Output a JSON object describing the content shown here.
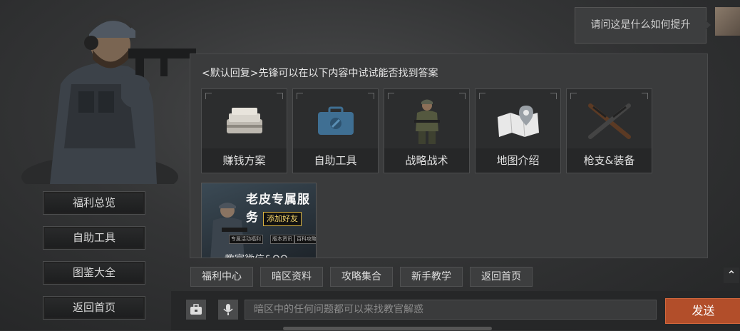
{
  "left_menu": {
    "items": [
      {
        "label": "福利总览"
      },
      {
        "label": "自助工具"
      },
      {
        "label": "图鉴大全"
      },
      {
        "label": "返回首页"
      }
    ]
  },
  "chat": {
    "user_message": "请问这是什么如何提升",
    "bot_reply": "<默认回复>先锋可以在以下内容中试试能否找到答案",
    "cards": [
      {
        "label": "赚钱方案",
        "icon": "cash-stack-icon"
      },
      {
        "label": "自助工具",
        "icon": "toolbox-icon"
      },
      {
        "label": "战略战术",
        "icon": "soldier-icon"
      },
      {
        "label": "地图介绍",
        "icon": "map-pin-icon"
      },
      {
        "label": "枪支&装备",
        "icon": "rifles-icon"
      }
    ],
    "promo": {
      "title": "老皮专属服务",
      "button": "添加好友",
      "rows": [
        "专属活动福利",
        "版本资讯",
        "百科攻略"
      ],
      "bottom_text": "教官微信&QQ"
    }
  },
  "quick_buttons": [
    {
      "label": "福利中心"
    },
    {
      "label": "暗区资料"
    },
    {
      "label": "攻略集合"
    },
    {
      "label": "新手教学"
    },
    {
      "label": "返回首页"
    }
  ],
  "input": {
    "placeholder": "暗区中的任何问题都可以来找教官解惑",
    "value": ""
  },
  "send_label": "发送",
  "colors": {
    "accent": "#b24e2a",
    "panel": "#3a3b3c",
    "background": "#343536"
  }
}
